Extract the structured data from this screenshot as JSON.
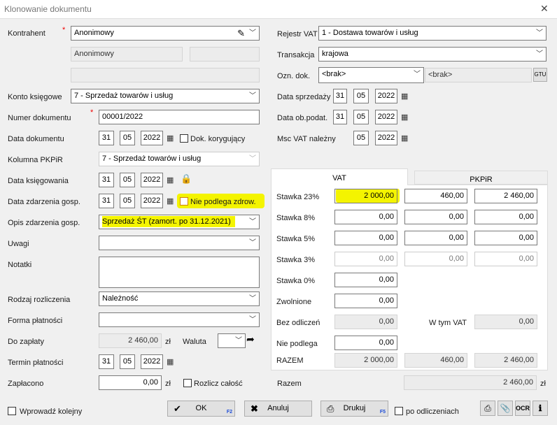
{
  "window": {
    "title": "Klonowanie dokumentu",
    "close": "✕"
  },
  "left": {
    "kontrahent_label": "Kontrahent",
    "required_mark": "*",
    "kontrahent_value": "Anonimowy",
    "kontrahent_name": "Anonimowy",
    "konto_label": "Konto księgowe",
    "konto_value": "7 - Sprzedaż towarów i usług",
    "numer_label": "Numer dokumentu",
    "numer_value": "00001/2022",
    "data_dok_label": "Data dokumentu",
    "data_dok": {
      "d": "31",
      "m": "05",
      "y": "2022"
    },
    "dok_kor_label": "Dok. korygujący",
    "kolumna_label": "Kolumna PKPiR",
    "kolumna_value": "7 - Sprzedaż towarów i usług",
    "data_ksieg_label": "Data księgowania",
    "data_ksieg": {
      "d": "31",
      "m": "05",
      "y": "2022"
    },
    "data_zdarz_label": "Data zdarzenia gosp.",
    "data_zdarz": {
      "d": "31",
      "m": "05",
      "y": "2022"
    },
    "nie_podlega_zdrow_label": "Nie podlega zdrow.",
    "opis_label": "Opis zdarzenia gosp.",
    "opis_value": "Sprzedaż ŚT (zamort. po 31.12.2021)",
    "uwagi_label": "Uwagi",
    "notatki_label": "Notatki",
    "rodzaj_label": "Rodzaj rozliczenia",
    "rodzaj_value": "Należność",
    "forma_label": "Forma płatności",
    "do_zaplaty_label": "Do zapłaty",
    "do_zaplaty_value": "2 460,00",
    "currency": "zł",
    "waluta_label": "Waluta",
    "termin_label": "Termin płatności",
    "termin": {
      "d": "31",
      "m": "05",
      "y": "2022"
    },
    "zaplacono_label": "Zapłacono",
    "zaplacono_value": "0,00",
    "rozlicz_label": "Rozlicz całość"
  },
  "right": {
    "rejestr_label": "Rejestr VAT",
    "rejestr_value": "1 - Dostawa towarów i usług",
    "transakcja_label": "Transakcja",
    "transakcja_value": "krajowa",
    "ozn_label": "Ozn. dok.",
    "ozn_value": "<brak>",
    "ozn_value2": "<brak>",
    "gtu": "GTU",
    "data_sprz_label": "Data sprzedaży",
    "data_sprz": {
      "d": "31",
      "m": "05",
      "y": "2022"
    },
    "data_ob_label": "Data ob.podat.",
    "data_ob": {
      "d": "31",
      "m": "05",
      "y": "2022"
    },
    "msc_label": "Msc VAT należny",
    "msc": {
      "m": "05",
      "y": "2022"
    },
    "tabs": {
      "vat": "VAT",
      "pkpir": "PKPiR"
    },
    "rows": [
      {
        "label": "Stawka 23%",
        "net": "2 000,00",
        "vat": "460,00",
        "gross": "2 460,00"
      },
      {
        "label": "Stawka 8%",
        "net": "0,00",
        "vat": "0,00",
        "gross": "0,00"
      },
      {
        "label": "Stawka 5%",
        "net": "0,00",
        "vat": "0,00",
        "gross": "0,00"
      },
      {
        "label": "Stawka 3%",
        "net": "0,00",
        "vat": "0,00",
        "gross": "0,00"
      },
      {
        "label": "Stawka 0%",
        "net": "0,00"
      },
      {
        "label": "Zwolnione",
        "net": "0,00"
      },
      {
        "label": "Bez odliczeń",
        "net": "0,00"
      },
      {
        "label": "Nie podlega",
        "net": "0,00"
      }
    ],
    "w_tym_vat_label": "W tym VAT",
    "w_tym_vat_value": "0,00",
    "razem_label": "RAZEM",
    "razem": {
      "net": "2 000,00",
      "vat": "460,00",
      "gross": "2 460,00"
    },
    "razem2_label": "Razem",
    "razem2_value": "2 460,00"
  },
  "footer": {
    "wprowadz_label": "Wprowadź kolejny",
    "ok_label": "OK",
    "ok_key": "F2",
    "anuluj_label": "Anuluj",
    "drukuj_label": "Drukuj",
    "drukuj_key": "F5",
    "po_odlicz_label": "po odliczeniach",
    "ocr": "OCR"
  }
}
